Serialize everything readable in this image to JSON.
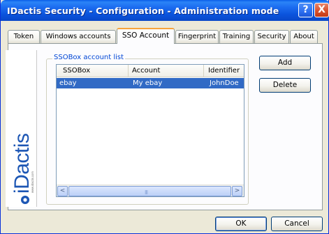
{
  "window": {
    "title": "IDactis Security - Configuration - Administration mode",
    "help_glyph": "?",
    "close_glyph": "X"
  },
  "tabs": [
    {
      "label": "Token",
      "active": false
    },
    {
      "label": "Windows accounts",
      "active": false
    },
    {
      "label": "SSO Account",
      "active": true
    },
    {
      "label": "Fingerprint",
      "active": false
    },
    {
      "label": "Training",
      "active": false
    },
    {
      "label": "Security",
      "active": false
    },
    {
      "label": "About",
      "active": false
    }
  ],
  "logo": {
    "text": "iDactis",
    "url": "www.idactis.com"
  },
  "sso": {
    "group_label": "SSOBox account list",
    "columns": [
      "SSOBox",
      "Account",
      "Identifier"
    ],
    "rows": [
      {
        "ssobox": "ebay",
        "account": "My ebay",
        "identifier": "JohnDoe",
        "selected": true
      }
    ],
    "scroll_left": "<",
    "scroll_right": ">",
    "scroll_grip": "III"
  },
  "buttons": {
    "add": "Add",
    "delete": "Delete",
    "ok": "OK",
    "cancel": "Cancel"
  },
  "colors": {
    "title_bar": "#0a53dc",
    "selection": "#316ac5",
    "active_tab_accent": "#f7a43c",
    "group_label": "#0046d5",
    "logo_blue": "#1c56b4"
  }
}
